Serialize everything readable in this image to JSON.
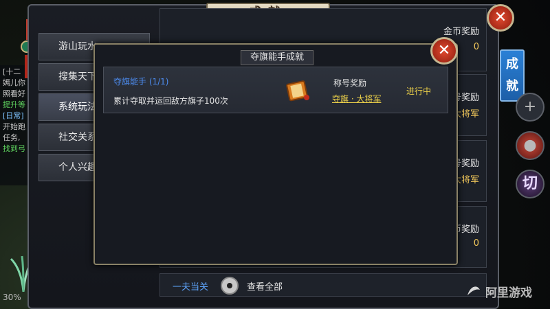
{
  "main": {
    "title": "成就",
    "close": "✕",
    "categories": [
      "游山玩水",
      "搜集天下",
      "系统玩法",
      "社交关系",
      "个人兴趣"
    ],
    "active_category": 2,
    "right_tab": [
      "成",
      "就"
    ],
    "rows": [
      {
        "reward_label": "金币奖励",
        "reward_value": "0"
      },
      {
        "reward_label": "称号奖励",
        "reward_value": "大将军"
      },
      {
        "reward_label": "称号奖励",
        "reward_value": "大将军"
      },
      {
        "reward_label": "金币奖励",
        "reward_value": "0"
      }
    ],
    "bottom": {
      "link": "一夫当关",
      "view_all": "查看全部"
    }
  },
  "chat": {
    "lines": [
      "[十二",
      "嫣儿你",
      "照看好",
      "提升等",
      "[日常]",
      "开始跑",
      "任务,",
      "找到弓"
    ]
  },
  "hud": {
    "percent": "30%"
  },
  "popup": {
    "title": "夺旗能手成就",
    "close": "✕",
    "achievement": {
      "name": "夺旗能手 (1/1)",
      "description": "累计夺取并运回敌方旗子100次",
      "reward_label": "称号奖励",
      "reward_value": "夺旗 · 大将军",
      "status": "进行中"
    }
  },
  "watermark": "阿里游戏",
  "colors": {
    "accent_blue": "#2a80d6",
    "gold": "#f0d44a",
    "link_blue": "#4d8cf0"
  },
  "icons": [
    "scroll-icon",
    "eye-icon",
    "close-icon",
    "plus-icon",
    "potion-icon",
    "skill-icon"
  ]
}
